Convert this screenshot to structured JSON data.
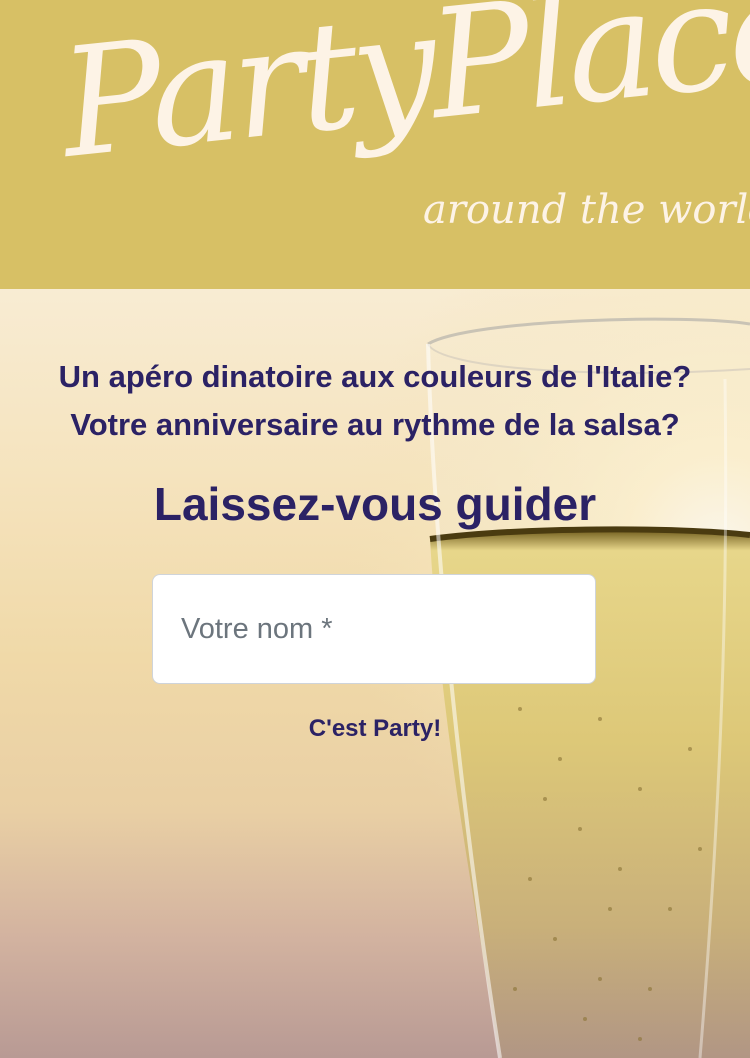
{
  "header": {
    "logo_title": "PartyPlace",
    "logo_tagline": "around the world"
  },
  "hero": {
    "question_1": "Un apéro dinatoire aux couleurs de l'Italie?",
    "question_2": "Votre anniversaire au rythme de la salsa?",
    "headline": "Laissez-vous guider"
  },
  "form": {
    "name_field": {
      "label": "Votre nom",
      "required_marker": " *",
      "value": ""
    },
    "submit_label": "C'est Party!"
  },
  "colors": {
    "header_bg": "#d7c065",
    "logo_text": "#fdf3e6",
    "heading_text": "#2b2265",
    "placeholder_text": "#6c757d"
  },
  "icons": {
    "hero_image": "champagne-glass-illustration"
  }
}
